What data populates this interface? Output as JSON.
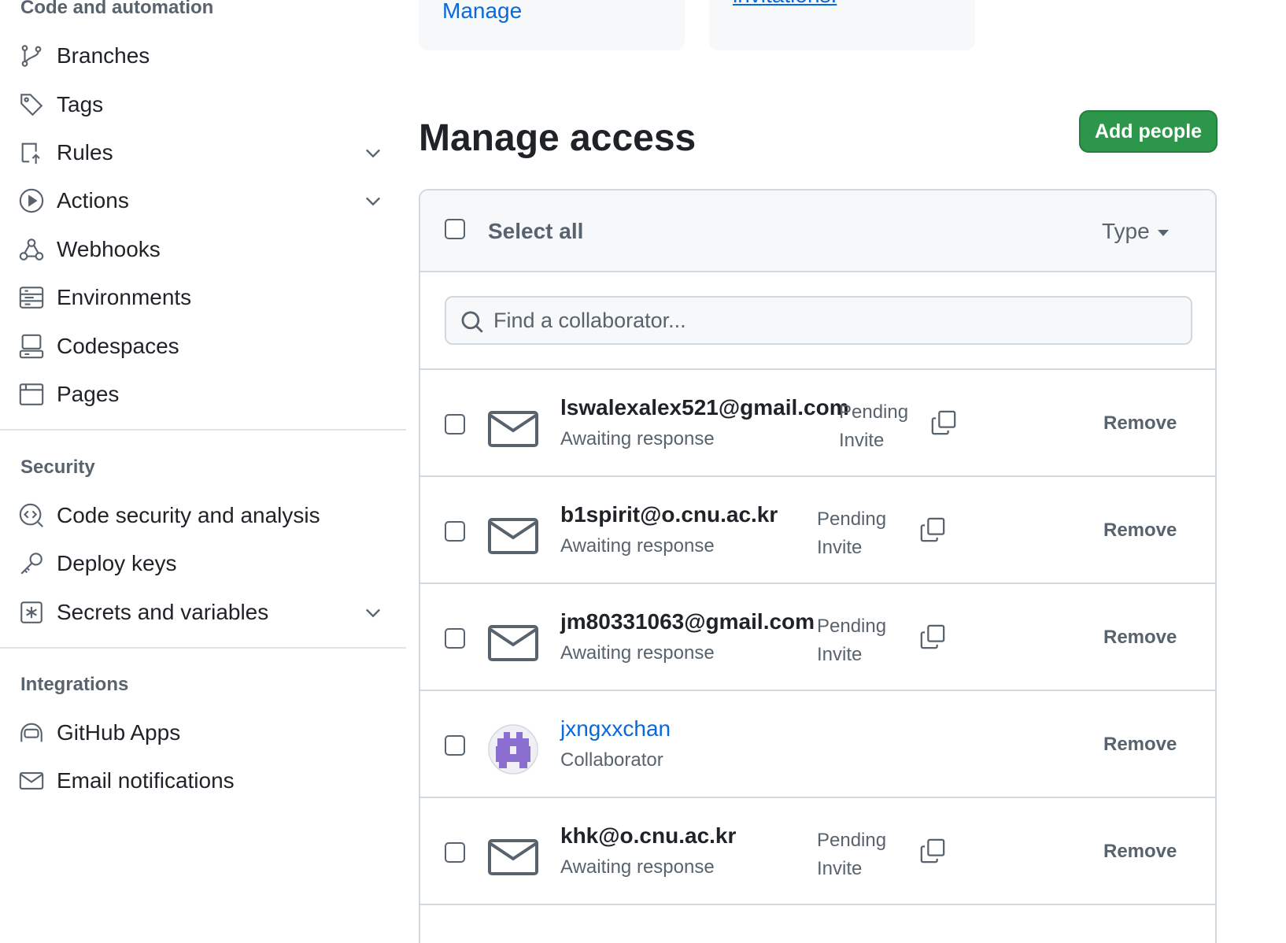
{
  "sidebar": {
    "code_section": "Code and automation",
    "items": [
      {
        "label": "Branches"
      },
      {
        "label": "Tags"
      },
      {
        "label": "Rules"
      },
      {
        "label": "Actions"
      },
      {
        "label": "Webhooks"
      },
      {
        "label": "Environments"
      },
      {
        "label": "Codespaces"
      },
      {
        "label": "Pages"
      }
    ],
    "security_section": "Security",
    "security_items": [
      {
        "label": "Code security and analysis"
      },
      {
        "label": "Deploy keys"
      },
      {
        "label": "Secrets and variables"
      }
    ],
    "integrations_section": "Integrations",
    "integrations_items": [
      {
        "label": "GitHub Apps"
      },
      {
        "label": "Email notifications"
      }
    ]
  },
  "top_cards": {
    "manage_link": "Manage",
    "invitations_link": "invitations."
  },
  "main": {
    "title": "Manage access",
    "add_button": "Add people",
    "select_all": "Select all",
    "type_filter": "Type",
    "search_placeholder": "Find a collaborator..."
  },
  "collaborators": [
    {
      "name": "lswalexalex521@gmail.com",
      "sub": "Awaiting response",
      "status1": "Pending",
      "status2": "Invite",
      "action": "Remove"
    },
    {
      "name": "b1spirit@o.cnu.ac.kr",
      "sub": "Awaiting response",
      "status1": "Pending",
      "status2": "Invite",
      "action": "Remove"
    },
    {
      "name": "jm80331063@gmail.com",
      "sub": "Awaiting response",
      "status1": "Pending",
      "status2": "Invite",
      "action": "Remove"
    },
    {
      "name": "jxngxxchan",
      "sub": "Collaborator",
      "action": "Remove"
    },
    {
      "name": "khk@o.cnu.ac.kr",
      "sub": "Awaiting response",
      "status1": "Pending",
      "status2": "Invite",
      "action": "Remove"
    }
  ],
  "colors": {
    "accent": "#0969da",
    "primary_button": "#2c974b",
    "muted_text": "#59636e",
    "border": "#d1d9e0",
    "avatar": "#8a6fd1"
  }
}
